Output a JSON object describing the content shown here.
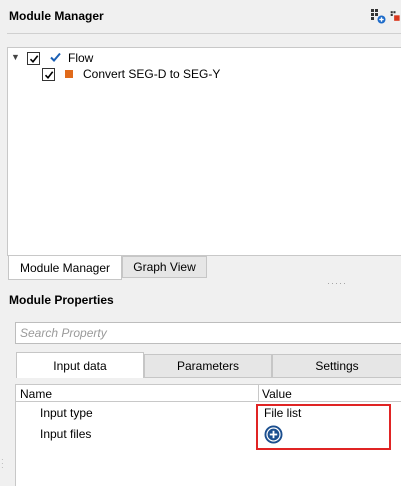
{
  "module_manager": {
    "title": "Module Manager",
    "tree": {
      "root": {
        "label": "Flow",
        "checked": true
      },
      "children": [
        {
          "label": "Convert SEG-D to SEG-Y",
          "checked": true
        }
      ]
    },
    "tabs": [
      {
        "label": "Module Manager",
        "active": true
      },
      {
        "label": "Graph View",
        "active": false
      }
    ],
    "header_icons": [
      "add-module-icon",
      "remove-module-icon"
    ]
  },
  "module_properties": {
    "title": "Module Properties",
    "search_placeholder": "Search Property",
    "tabs": [
      {
        "label": "Input data",
        "active": true
      },
      {
        "label": "Parameters",
        "active": false
      },
      {
        "label": "Settings",
        "active": false
      }
    ],
    "columns": [
      "Name",
      "Value"
    ],
    "rows": [
      {
        "name": "Input type",
        "value": "File list"
      },
      {
        "name": "Input files",
        "value_icon": "add-circle-icon"
      }
    ]
  },
  "colors": {
    "highlight": "#e02424",
    "flow_check": "#1a5fb4",
    "module_square": "#e06a1b",
    "add_button": "#1b4f8f"
  }
}
